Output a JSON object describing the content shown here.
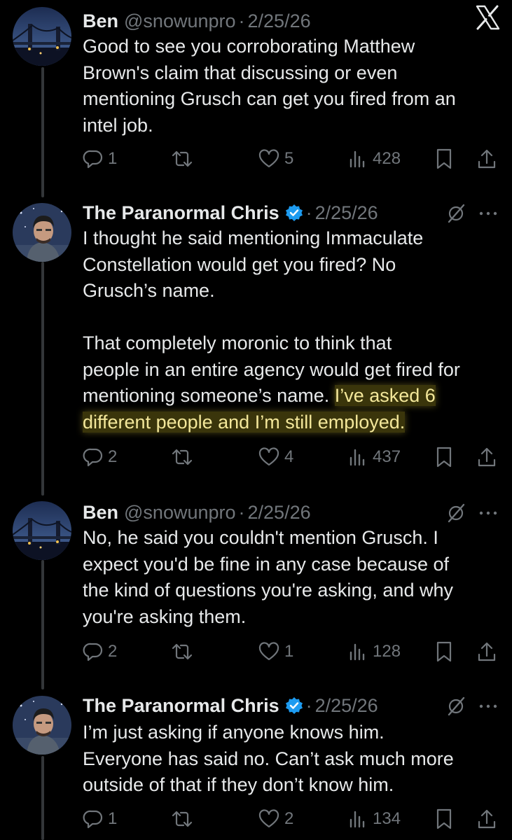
{
  "colors": {
    "background": "#000000",
    "text": "#e7e9ea",
    "muted": "#71767b",
    "verified": "#1d9bf0",
    "highlight": "#f3e79a"
  },
  "brand_icon": "x-logo-icon",
  "tweets": [
    {
      "name": "Ben",
      "handle": "@snowunpro",
      "dot": "·",
      "date": "2/25/26",
      "verified": false,
      "lines": [
        "Good to see you corroborating Matthew",
        "Brown's claim that discussing or even",
        "mentioning Grusch can get you fired from an",
        "intel job."
      ],
      "replies": "1",
      "reposts": "",
      "likes": "5",
      "views": "428"
    },
    {
      "name": "The Paranormal Chris",
      "handle": "",
      "dot": "·",
      "date": "2/25/26",
      "verified": true,
      "lines_a": [
        "I thought he said mentioning Immaculate",
        "Constellation would get you fired? No",
        "Grusch’s name."
      ],
      "lines_b_1": "That completely moronic to think that",
      "lines_b_2": "people in an entire agency would get fired for",
      "lines_b_3_plain": "mentioning someone’s name. ",
      "lines_b_3_hl": "I’ve asked 6",
      "lines_b_4_hl": "different people and I’m still employed.",
      "replies": "2",
      "reposts": "",
      "likes": "4",
      "views": "437"
    },
    {
      "name": "Ben",
      "handle": "@snowunpro",
      "dot": "·",
      "date": "2/25/26",
      "verified": false,
      "lines": [
        "No, he said you couldn't mention Grusch. I",
        "expect you'd be fine in any case because of",
        "the kind of questions you're asking, and why",
        "you're asking them."
      ],
      "replies": "2",
      "reposts": "",
      "likes": "1",
      "views": "128"
    },
    {
      "name": "The Paranormal Chris",
      "handle": "",
      "dot": "·",
      "date": "2/25/26",
      "verified": true,
      "lines": [
        "I’m just asking if anyone knows him.",
        "Everyone has said no. Can’t ask much more",
        "outside of that if they don’t know him."
      ],
      "replies": "1",
      "reposts": "",
      "likes": "2",
      "views": "134"
    }
  ]
}
